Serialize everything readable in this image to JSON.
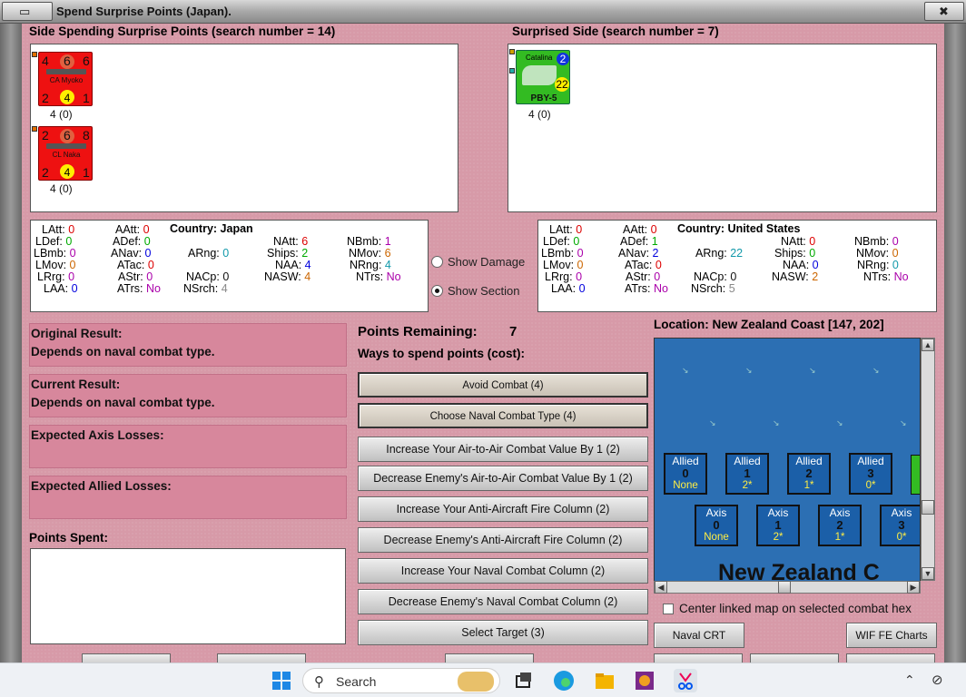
{
  "window": {
    "title": "Spend Surprise Points (Japan)."
  },
  "spending_side": {
    "header": "Side Spending Surprise Points (search number = 14)",
    "units": [
      {
        "name": "CA Myoko",
        "tl": "4",
        "tm": "6",
        "tr": "6",
        "bl": "2",
        "bm": "4",
        "br": "1",
        "caption": "4 (0)"
      },
      {
        "name": "CL Naka",
        "tl": "2",
        "tm": "6",
        "tr": "8",
        "bl": "2",
        "bm": "4",
        "br": "1",
        "caption": "4 (0)"
      }
    ]
  },
  "surprised_side": {
    "header": "Surprised Side (search number = 7)",
    "units": [
      {
        "name": "PBY-5",
        "label": "Catalina",
        "rng": "2",
        "val": "22",
        "caption": "4 (0)"
      }
    ]
  },
  "stats_japan": {
    "latt": "LAtt:",
    "latt_v": "0",
    "aatt": "AAtt:",
    "aatt_v": "0",
    "country": "Country: Japan",
    "ldef": "LDef:",
    "ldef_v": "0",
    "adef": "ADef:",
    "adef_v": "0",
    "natt": "NAtt:",
    "natt_v": "6",
    "nbmb": "NBmb:",
    "nbmb_v": "1",
    "lbmb": "LBmb:",
    "lbmb_v": "0",
    "anav": "ANav:",
    "anav_v": "0",
    "arng": "ARng:",
    "arng_v": "0",
    "ships": "Ships:",
    "ships_v": "2",
    "nmov": "NMov:",
    "nmov_v": "6",
    "lmov": "LMov:",
    "lmov_v": "0",
    "atac": "ATac:",
    "atac_v": "0",
    "naa": "NAA:",
    "naa_v": "4",
    "nrng": "NRng:",
    "nrng_v": "4",
    "lrrg": "LRrg:",
    "lrrg_v": "0",
    "astr": "AStr:",
    "astr_v": "0",
    "nacp": "NACp:",
    "nacp_v": "0",
    "nasw": "NASW:",
    "nasw_v": "4",
    "ntrs": "NTrs:",
    "ntrs_v": "No",
    "laa": "LAA:",
    "laa_v": "0",
    "atrs": "ATrs:",
    "atrs_v": "No",
    "nsrch": "NSrch:",
    "nsrch_v": "4"
  },
  "stats_us": {
    "latt": "LAtt:",
    "latt_v": "0",
    "aatt": "AAtt:",
    "aatt_v": "0",
    "country": "Country: United States",
    "ldef": "LDef:",
    "ldef_v": "0",
    "adef": "ADef:",
    "adef_v": "1",
    "natt": "NAtt:",
    "natt_v": "0",
    "nbmb": "NBmb:",
    "nbmb_v": "0",
    "lbmb": "LBmb:",
    "lbmb_v": "0",
    "anav": "ANav:",
    "anav_v": "2",
    "arng": "ARng:",
    "arng_v": "22",
    "ships": "Ships:",
    "ships_v": "0",
    "nmov": "NMov:",
    "nmov_v": "0",
    "lmov": "LMov:",
    "lmov_v": "0",
    "atac": "ATac:",
    "atac_v": "0",
    "naa": "NAA:",
    "naa_v": "0",
    "nrng": "NRng:",
    "nrng_v": "0",
    "lrrg": "LRrg:",
    "lrrg_v": "0",
    "astr": "AStr:",
    "astr_v": "0",
    "nacp": "NACp:",
    "nacp_v": "0",
    "nasw": "NASW:",
    "nasw_v": "2",
    "ntrs": "NTrs:",
    "ntrs_v": "No",
    "laa": "LAA:",
    "laa_v": "0",
    "atrs": "ATrs:",
    "atrs_v": "No",
    "nsrch": "NSrch:",
    "nsrch_v": "5"
  },
  "options": {
    "show_damage": "Show Damage",
    "show_section": "Show Section",
    "selected": "show_section"
  },
  "results": {
    "original_title": "Original Result:",
    "original_value": "Depends on naval combat type.",
    "current_title": "Current Result:",
    "current_value": "Depends on naval combat type.",
    "axis_losses": "Expected Axis Losses:",
    "allied_losses": "Expected Allied Losses:",
    "points_spent": "Points Spent:"
  },
  "points": {
    "remaining_label": "Points Remaining:",
    "remaining_value": "7",
    "ways_label": "Ways to spend points (cost):"
  },
  "actions": [
    "Avoid Combat (4)",
    "Choose Naval Combat Type (4)",
    "Increase Your Air-to-Air Combat Value By 1 (2)",
    "Decrease Enemy's Air-to-Air Combat Value By 1 (2)",
    "Increase Your Anti-Aircraft Fire Column (2)",
    "Decrease Enemy's Anti-Aircraft Fire Column (2)",
    "Increase Your Naval Combat Column (2)",
    "Decrease Enemy's Naval Combat Column (2)",
    "Select Target (3)"
  ],
  "map": {
    "location": "Location: New Zealand Coast [147, 202]",
    "title": "New Zealand C",
    "allied": [
      {
        "a": "Allied",
        "b": "0",
        "c": "None"
      },
      {
        "a": "Allied",
        "b": "1",
        "c": "2*"
      },
      {
        "a": "Allied",
        "b": "2",
        "c": "1*"
      },
      {
        "a": "Allied",
        "b": "3",
        "c": "0*"
      }
    ],
    "axis": [
      {
        "a": "Axis",
        "b": "0",
        "c": "None"
      },
      {
        "a": "Axis",
        "b": "1",
        "c": "2*"
      },
      {
        "a": "Axis",
        "b": "2",
        "c": "1*"
      },
      {
        "a": "Axis",
        "b": "3",
        "c": "0*"
      }
    ],
    "center_label": "Center linked map on selected combat hex"
  },
  "buttons": {
    "naval_crt": "Naval CRT",
    "wif_charts": "WIF FE Charts"
  },
  "taskbar": {
    "search_label": "Search"
  }
}
